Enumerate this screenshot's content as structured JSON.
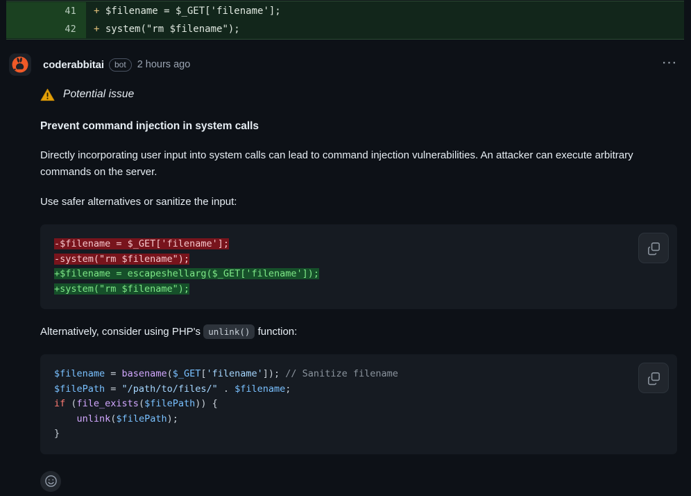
{
  "diff": {
    "lines": [
      {
        "number": "41",
        "sign": "+",
        "code": " $filename = $_GET['filename'];"
      },
      {
        "number": "42",
        "sign": "+",
        "code": " system(\"rm $filename\");"
      }
    ]
  },
  "comment": {
    "avatar_icon": "rabbit-avatar-icon",
    "author": "coderabbitai",
    "bot_badge": "bot",
    "timestamp": "2 hours ago",
    "menu_icon": "kebab-menu-icon",
    "badge": {
      "icon": "warning-triangle-icon",
      "label": "Potential issue"
    },
    "title": "Prevent command injection in system calls",
    "paragraph_1": "Directly incorporating user input into system calls can lead to command injection vulnerabilities. An attacker can execute arbitrary commands on the server.",
    "paragraph_2": "Use safer alternatives or sanitize the input:",
    "alt_prefix": "Alternatively, consider using PHP's",
    "alt_code": "unlink()",
    "alt_suffix": "function:",
    "code_block_1": {
      "copy_icon": "copy-icon",
      "lines": [
        {
          "type": "del",
          "text": "-$filename = $_GET['filename'];"
        },
        {
          "type": "del",
          "text": "-system(\"rm $filename\");"
        },
        {
          "type": "add",
          "text": "+$filename = escapeshellarg($_GET['filename']);"
        },
        {
          "type": "add",
          "text": "+system(\"rm $filename\");"
        }
      ]
    },
    "code_block_2": {
      "copy_icon": "copy-icon",
      "lines": [
        "$filename = basename($_GET['filename']); // Sanitize filename",
        "$filePath = \"/path/to/files/\" . $filename;",
        "if (file_exists($filePath)) {",
        "    unlink($filePath);",
        "}"
      ]
    },
    "reaction_button_icon": "smiley-face-icon"
  },
  "colors": {
    "page_bg": "#0d1117",
    "code_bg": "#161b22",
    "diff_add_bg": "#12261b",
    "diff_gutter_bg": "#1b4121",
    "accent_orange": "#f05a28",
    "warning_amber": "#e3a008",
    "del_bg": "#78141c",
    "add_bg": "#16502a"
  }
}
